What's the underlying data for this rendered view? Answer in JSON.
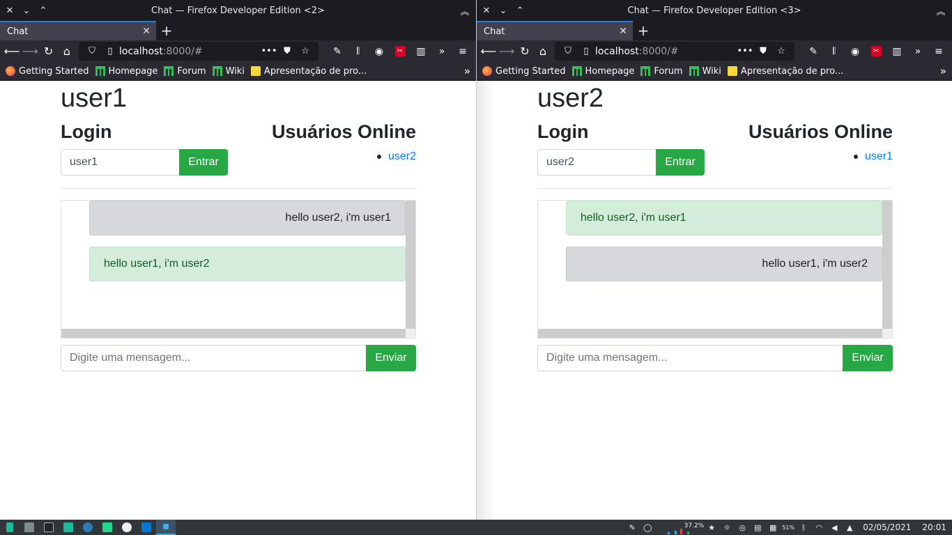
{
  "windows": [
    {
      "title": "Chat — Firefox Developer Edition <2>",
      "tab": "Chat",
      "url_host": "localhost",
      "url_path": ":8000/#",
      "bookmarks": [
        "Getting Started",
        "Homepage",
        "Forum",
        "Wiki",
        "Apresentação de pro..."
      ],
      "page": {
        "heading": "user1",
        "login_title": "Login",
        "login_value": "user1",
        "login_button": "Entrar",
        "online_title": "Usuários Online",
        "online_users": [
          "user2"
        ],
        "messages": [
          {
            "text": "hello user2, i'm user1",
            "style": "grey"
          },
          {
            "text": "hello user1, i'm user2",
            "style": "green"
          }
        ],
        "message_placeholder": "Digite uma mensagem...",
        "send_button": "Enviar"
      }
    },
    {
      "title": "Chat — Firefox Developer Edition <3>",
      "tab": "Chat",
      "url_host": "localhost",
      "url_path": ":8000/#",
      "bookmarks": [
        "Getting Started",
        "Homepage",
        "Forum",
        "Wiki",
        "Apresentação de pro..."
      ],
      "page": {
        "heading": "user2",
        "login_title": "Login",
        "login_value": "user2",
        "login_button": "Entrar",
        "online_title": "Usuários Online",
        "online_users": [
          "user1"
        ],
        "messages": [
          {
            "text": "hello user2, i'm user1",
            "style": "green"
          },
          {
            "text": "hello user1, i'm user2",
            "style": "grey"
          }
        ],
        "message_placeholder": "Digite uma mensagem...",
        "send_button": "Enviar"
      }
    }
  ],
  "taskbar": {
    "cpu": "37.2%",
    "battery": "51%",
    "date": "02/05/2021",
    "time": "20:01"
  },
  "colors": {
    "success": "#28a745",
    "link": "#007bff",
    "browser_chrome": "#2b2a33",
    "titlebar": "#1c1b22"
  }
}
